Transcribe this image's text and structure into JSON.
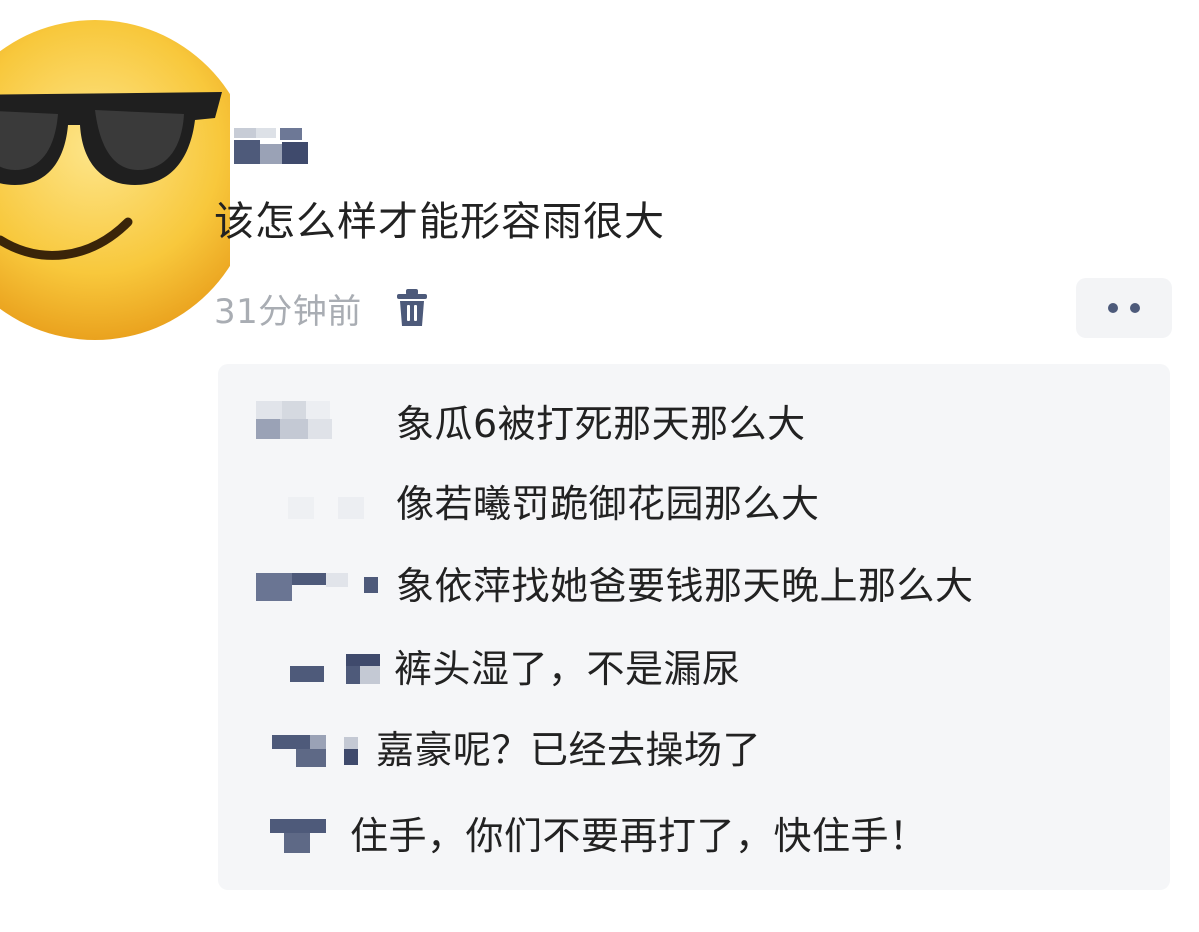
{
  "post": {
    "avatar_icon": "sunglasses-emoji-icon",
    "username_obscured": true,
    "text": "该怎么样才能形容雨很大",
    "timestamp": "31分钟前",
    "delete_icon": "trash-icon",
    "more_icon": "more-dots-icon"
  },
  "replies": [
    {
      "text": "象瓜6被打死那天那么大"
    },
    {
      "text": "像若曦罚跪御花园那么大"
    },
    {
      "text": "象依萍找她爸要钱那天晚上那么大"
    },
    {
      "text": "裤头湿了，不是漏尿"
    },
    {
      "text": "嘉豪呢？已经去操场了"
    },
    {
      "text": "住手，你们不要再打了，快住手！"
    }
  ],
  "colors": {
    "accent": "#4d5a7a",
    "timestamp": "#a9adb3",
    "reply_bg": "#f5f6f8"
  }
}
